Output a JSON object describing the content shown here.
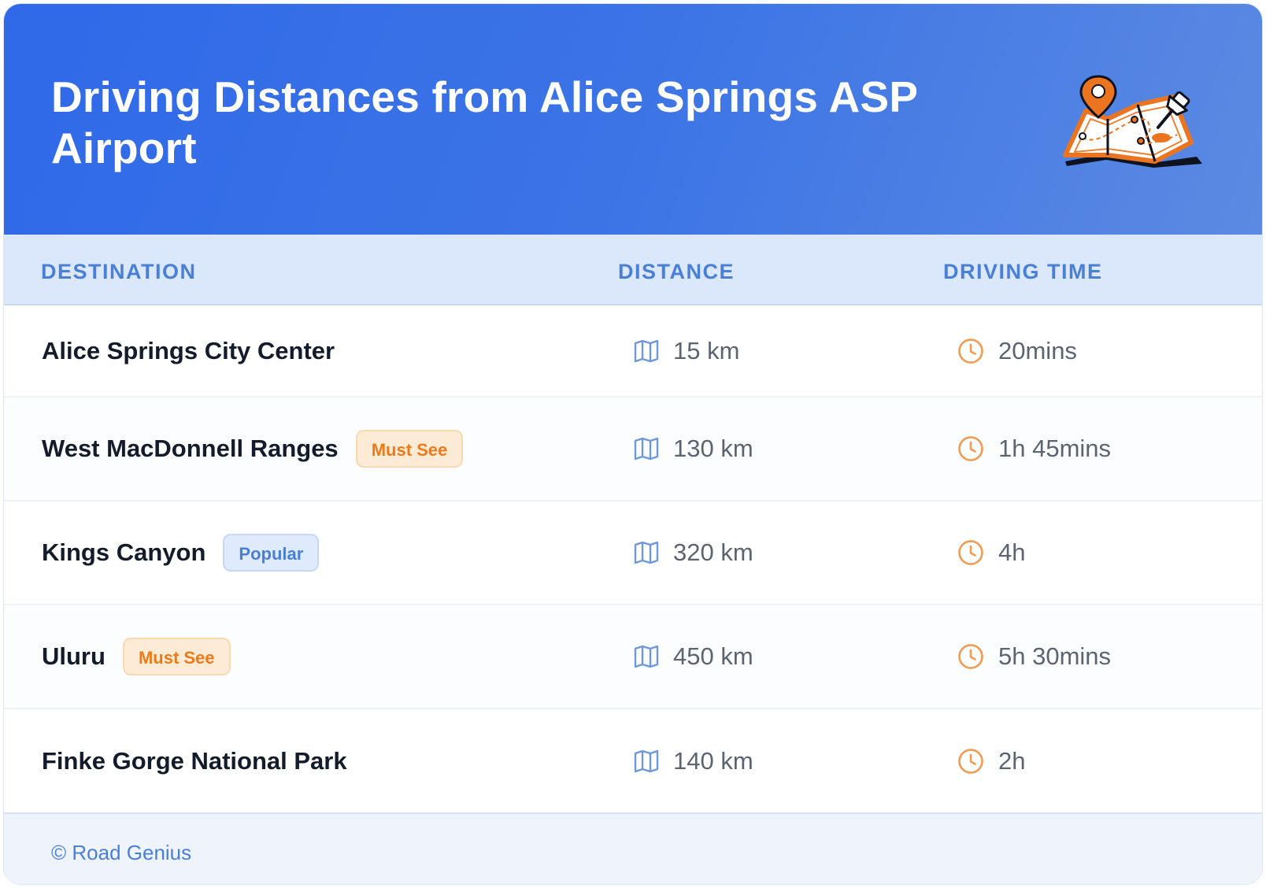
{
  "header": {
    "title": "Driving Distances from Alice Springs ASP Airport",
    "illustration_icon": "map-with-pins-icon",
    "gradient_start": "#2f69e8",
    "gradient_end": "#5b8ae2"
  },
  "table": {
    "columns": [
      "DESTINATION",
      "DISTANCE",
      "DRIVING TIME"
    ],
    "distance_icon": "map-icon",
    "time_icon": "clock-icon",
    "rows": [
      {
        "destination": "Alice Springs City Center",
        "badge": "",
        "badge_type": "",
        "distance": "15 km",
        "time": "20mins"
      },
      {
        "destination": "West MacDonnell Ranges",
        "badge": "Must See",
        "badge_type": "must",
        "distance": "130 km",
        "time": "1h 45mins"
      },
      {
        "destination": "Kings Canyon",
        "badge": "Popular",
        "badge_type": "popular",
        "distance": "320 km",
        "time": "4h"
      },
      {
        "destination": "Uluru",
        "badge": "Must See",
        "badge_type": "must",
        "distance": "450 km",
        "time": "5h 30mins"
      },
      {
        "destination": "Finke Gorge National Park",
        "badge": "",
        "badge_type": "",
        "distance": "140 km",
        "time": "2h"
      }
    ]
  },
  "footer": {
    "copyright": "© Road Genius"
  },
  "colors": {
    "accent_blue": "#4a7fd6",
    "accent_orange": "#ee7a1a"
  }
}
